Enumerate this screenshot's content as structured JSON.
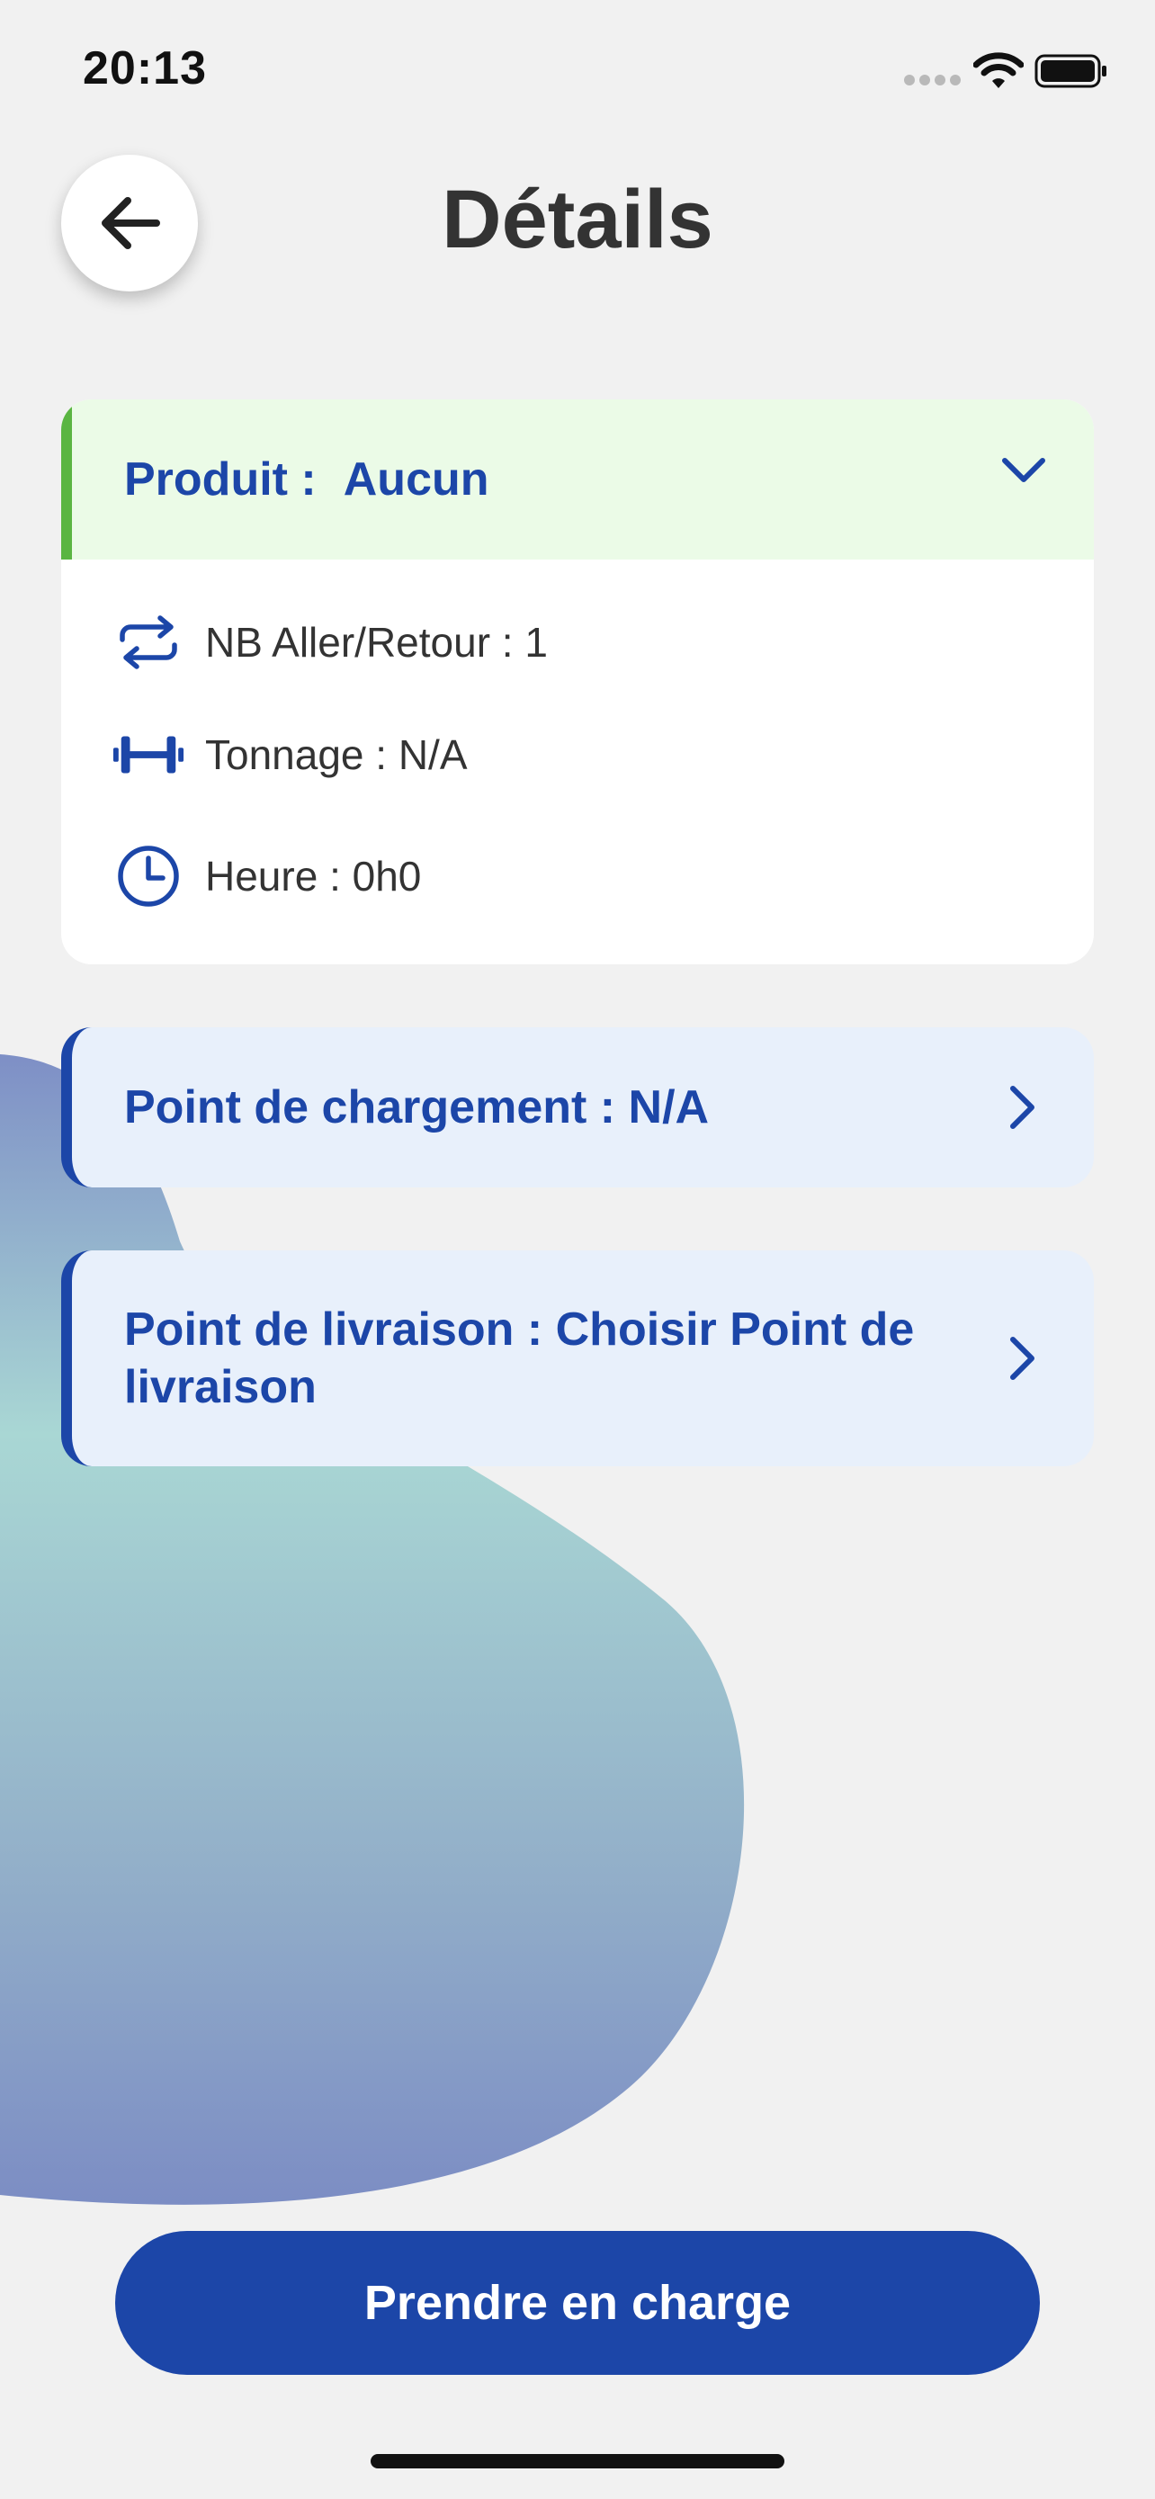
{
  "status_bar": {
    "time": "20:13",
    "icons": [
      "cellular-icon",
      "wifi-icon",
      "battery-icon"
    ]
  },
  "header": {
    "title": "Détails",
    "back_icon": "arrow-left-icon"
  },
  "product_card": {
    "label": "Produit :",
    "value": "Aucun",
    "toggle_icon": "chevron-down-icon",
    "accent_color": "#5ab542",
    "rows": [
      {
        "icon": "swap-arrows-icon",
        "text": "NB Aller/Retour : 1"
      },
      {
        "icon": "dumbbell-icon",
        "text": "Tonnage : N/A"
      },
      {
        "icon": "clock-icon",
        "text": "Heure : 0h0"
      }
    ]
  },
  "loading_point": {
    "label": "Point de chargement : N/A",
    "icon": "chevron-right-icon"
  },
  "delivery_point": {
    "label": "Point de livraison : Choisir Point de livraison",
    "icon": "chevron-right-icon"
  },
  "primary_button": {
    "label": "Prendre en charge",
    "color": "#1c46a8"
  }
}
